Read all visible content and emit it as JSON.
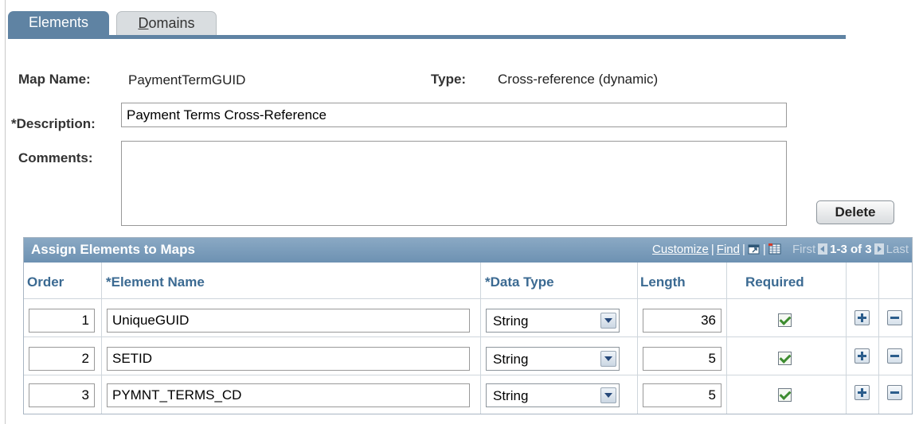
{
  "tabs": [
    {
      "label_first": "D",
      "label": "Elements"
    },
    {
      "label_first": "D",
      "label_rest": "omains",
      "label": "Domains"
    }
  ],
  "form": {
    "map_name_label": "Map Name:",
    "map_name_value": "PaymentTermGUID",
    "type_label": "Type:",
    "type_value": "Cross-reference (dynamic)",
    "description_label": "*Description:",
    "description_value": "Payment Terms Cross-Reference",
    "comments_label": "Comments:",
    "comments_value": "",
    "delete_label": "Delete"
  },
  "grid": {
    "title": "Assign Elements to Maps",
    "customize": "Customize",
    "find": "Find",
    "sep": "|",
    "first": "First",
    "range": "1-3 of 3",
    "last": "Last",
    "columns": {
      "order": "Order",
      "element_name": "*Element Name",
      "data_type": "*Data Type",
      "length": "Length",
      "required": "Required"
    },
    "rows": [
      {
        "order": "1",
        "element_name": "UniqueGUID",
        "data_type": "String",
        "length": "36",
        "required": true
      },
      {
        "order": "2",
        "element_name": "SETID",
        "data_type": "String",
        "length": "5",
        "required": true
      },
      {
        "order": "3",
        "element_name": "PYMNT_TERMS_CD",
        "data_type": "String",
        "length": "5",
        "required": true
      }
    ]
  },
  "colors": {
    "tab_active": "#5f83a3",
    "grid_header": "#6d91b2",
    "column_header_text": "#3b6a92"
  }
}
